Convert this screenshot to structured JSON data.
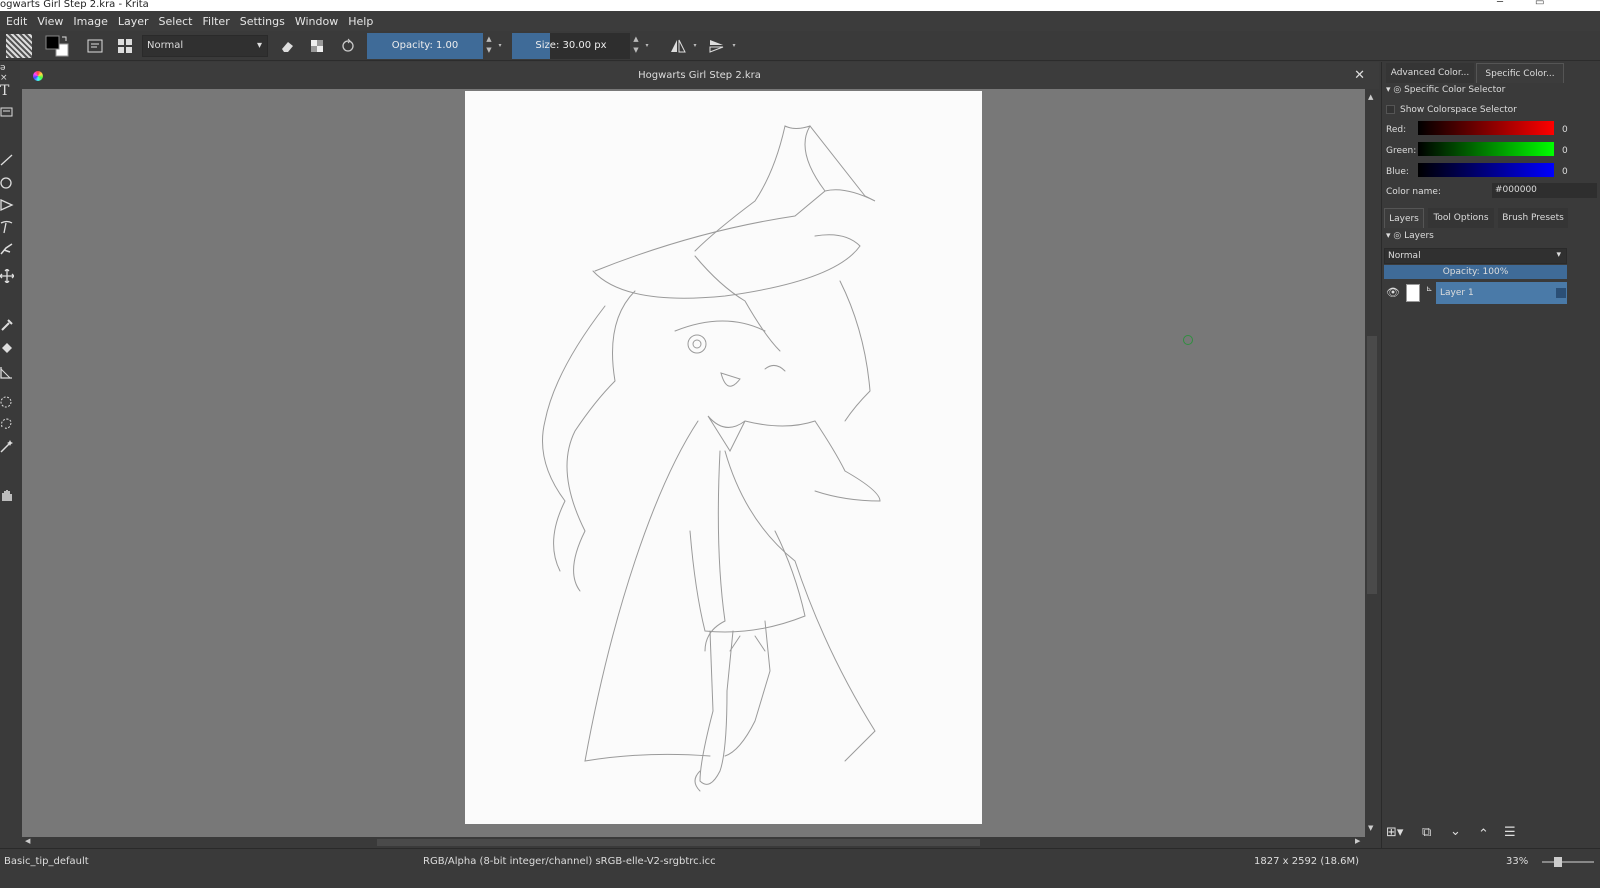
{
  "window": {
    "title": "ogwarts Girl Step 2.kra  - Krita"
  },
  "menu": [
    "Edit",
    "View",
    "Image",
    "Layer",
    "Select",
    "Filter",
    "Settings",
    "Window",
    "Help"
  ],
  "toolbar": {
    "blend_mode": "Normal",
    "opacity_label": "Opacity:  1.00",
    "opacity": 1.0,
    "size_label": "Size:  30.00 px",
    "size_fraction": 0.32
  },
  "document": {
    "title": "Hogwarts Girl Step 2.kra"
  },
  "color_panel": {
    "tabs": [
      "Advanced Color...",
      "Specific Color..."
    ],
    "header": "Specific Color Selector",
    "show_colorspace": "Show Colorspace Selector",
    "channels": [
      {
        "label": "Red:",
        "value": "0",
        "color": "#ff0000"
      },
      {
        "label": "Green:",
        "value": "0",
        "color": "#00ff00"
      },
      {
        "label": "Blue:",
        "value": "0",
        "color": "#0000ff"
      }
    ],
    "color_name_label": "Color name:",
    "color_name_value": "#000000"
  },
  "layers_panel": {
    "tabs": [
      "Layers",
      "Tool Options",
      "Brush Presets"
    ],
    "header": "Layers",
    "blend_mode": "Normal",
    "opacity_label": "Opacity:  100%",
    "layers": [
      {
        "name": "Layer 1"
      }
    ]
  },
  "status": {
    "brush": "Basic_tip_default",
    "colorspace": "RGB/Alpha (8-bit integer/channel)  sRGB-elle-V2-srgbtrc.icc",
    "dimensions": "1827 x 2592 (18.6M)",
    "zoom": "33%"
  },
  "colors": {
    "accent": "#3f6b98",
    "selected_layer": "#4a7aa8"
  }
}
